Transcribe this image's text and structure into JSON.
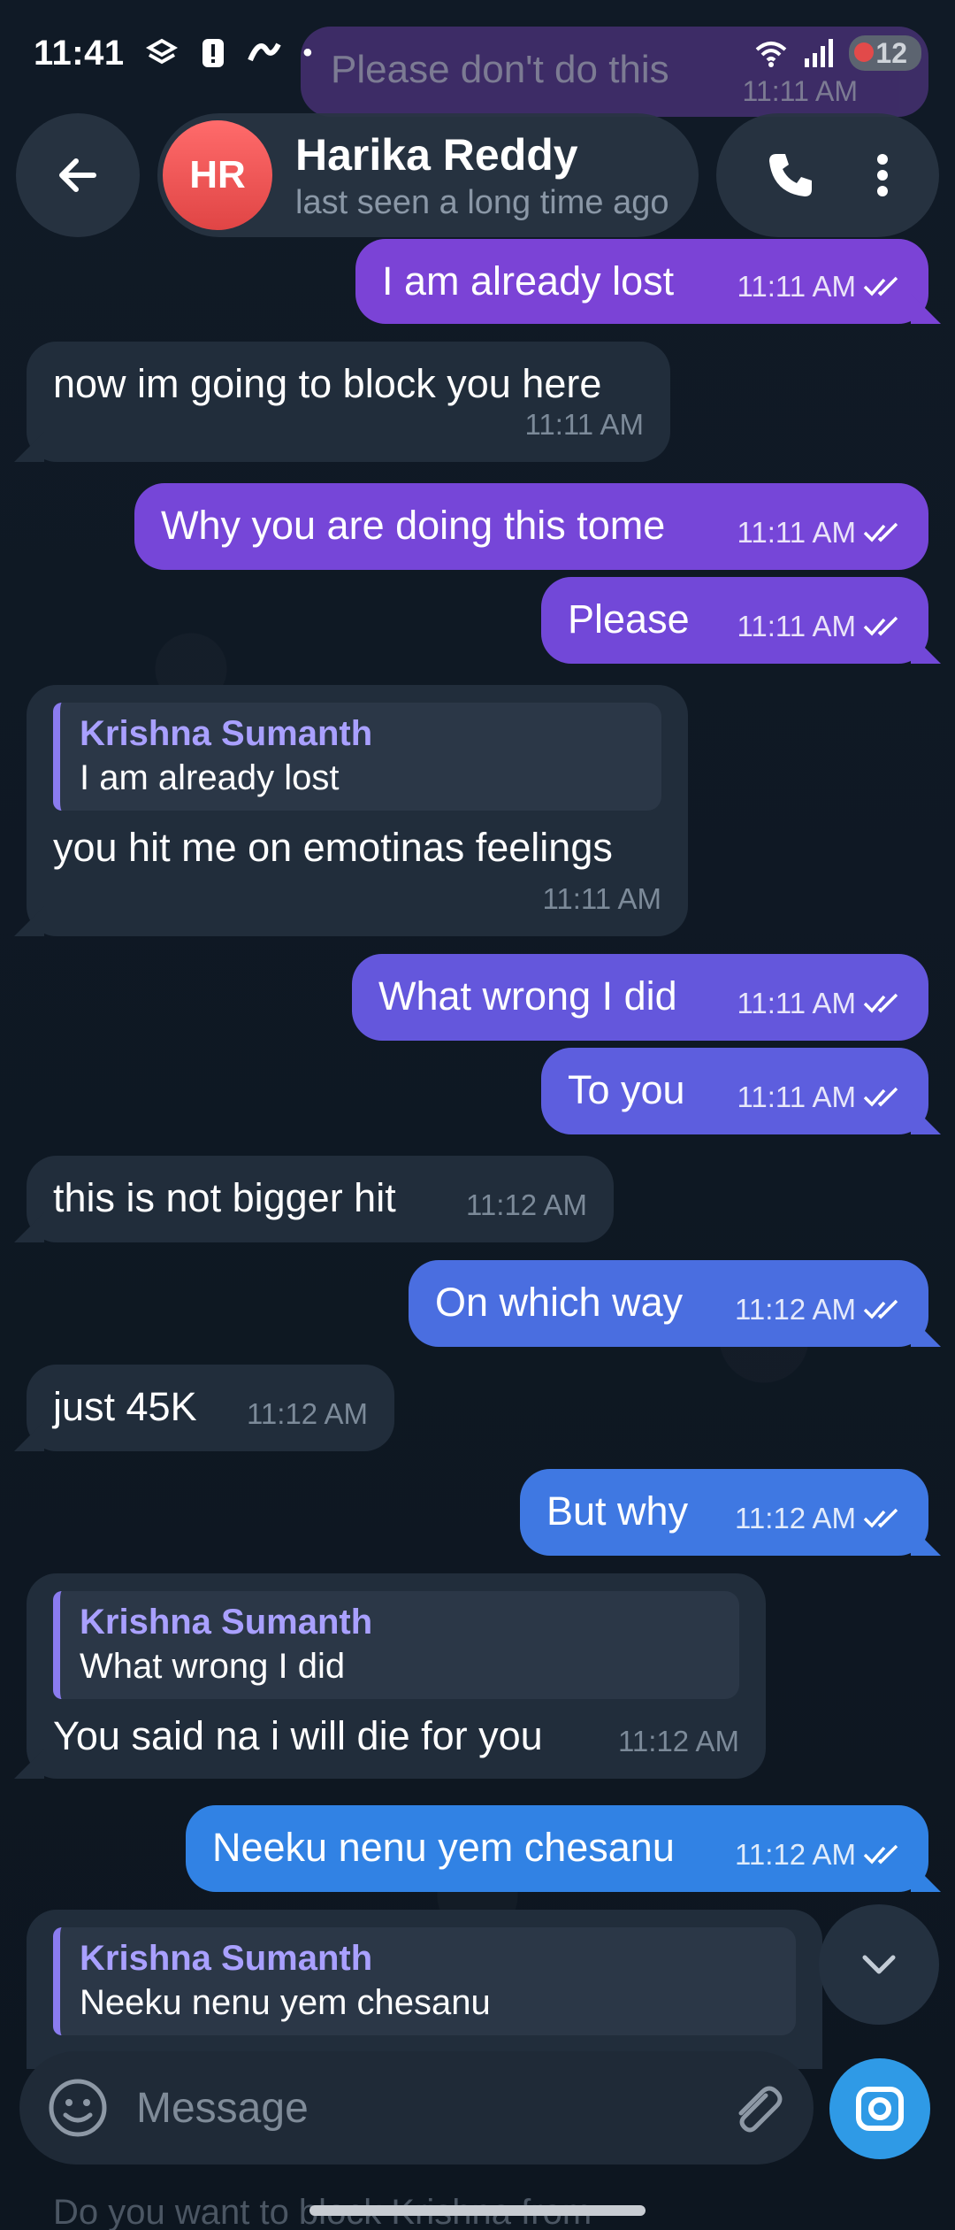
{
  "status_bar": {
    "time": "11:41",
    "dot": "•",
    "battery": "12"
  },
  "ghost_message": {
    "text": "Please don't do this",
    "time": "11:11 AM"
  },
  "header": {
    "avatar_initials": "HR",
    "contact_name": "Harika Reddy",
    "last_seen": "last seen a long time ago",
    "avatar_color": "#e8504f"
  },
  "messages": [
    {
      "dir": "out",
      "text": "I am already lost",
      "time": "11:11 AM",
      "color": "#7b43d6"
    },
    {
      "dir": "in",
      "text": "now im going to block you here",
      "time": "11:11 AM"
    },
    {
      "dir": "out",
      "text": "Why you are doing this tome",
      "time": "11:11 AM",
      "color": "#7646d8"
    },
    {
      "dir": "out",
      "text": "Please",
      "time": "11:11 AM",
      "color": "#7248d8"
    },
    {
      "dir": "in",
      "reply_author": "Krishna Sumanth",
      "reply_text": "I am already lost",
      "text": "you hit me on emotinas feelings",
      "time": "11:11 AM"
    },
    {
      "dir": "out",
      "text": "What wrong I did",
      "time": "11:11 AM",
      "color": "#6457dc"
    },
    {
      "dir": "out",
      "text": "To you",
      "time": "11:11 AM",
      "color": "#5d5ede"
    },
    {
      "dir": "in",
      "text": "this is not bigger hit",
      "time": "11:12 AM"
    },
    {
      "dir": "out",
      "text": "On which way",
      "time": "11:12 AM",
      "color": "#4a6ee0"
    },
    {
      "dir": "in",
      "text": "just 45K",
      "time": "11:12 AM"
    },
    {
      "dir": "out",
      "text": "But why",
      "time": "11:12 AM",
      "color": "#3f78e2"
    },
    {
      "dir": "in",
      "reply_author": "Krishna Sumanth",
      "reply_text": "What wrong I did",
      "text": "You said na i will die for you",
      "time": "11:12 AM"
    },
    {
      "dir": "out",
      "text": "Neeku nenu yem chesanu",
      "time": "11:12 AM",
      "color": "#3182e4"
    },
    {
      "dir": "in",
      "reply_author": "Krishna Sumanth",
      "reply_text": "Neeku nenu yem chesanu"
    }
  ],
  "input": {
    "placeholder": "Message"
  },
  "bottom_ghost_text": "Do you want to block Krishna from",
  "icons": [
    "back-arrow-icon",
    "phone-icon",
    "more-vertical-icon",
    "chevron-down-icon",
    "emoji-icon",
    "paperclip-icon",
    "camera-icon",
    "double-check-icon"
  ]
}
